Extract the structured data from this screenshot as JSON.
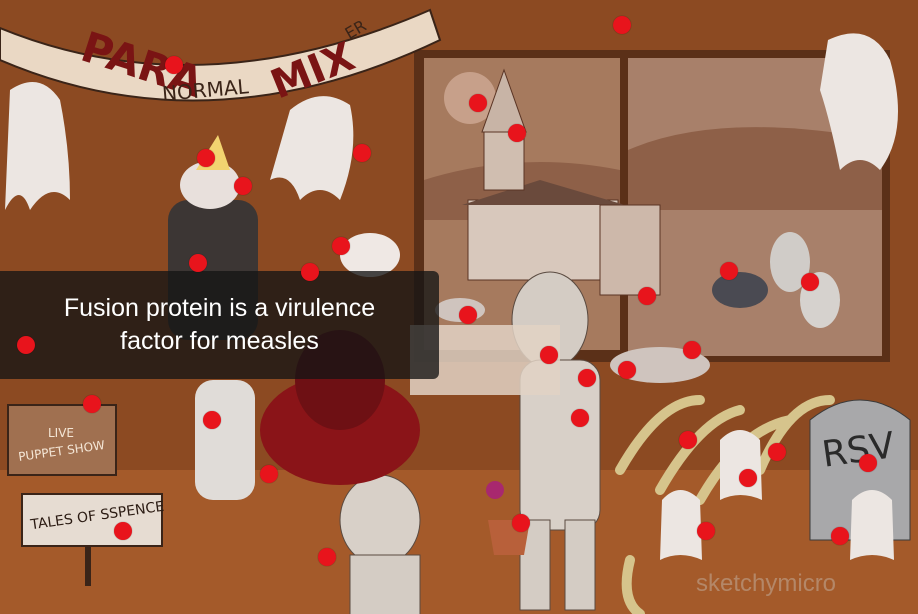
{
  "caption": {
    "line1": "Fusion protein is a virulence",
    "line2": "factor for measles"
  },
  "banner": {
    "para": "PARA",
    "normal": "NORMAL",
    "mix": "MIX",
    "er": "ER"
  },
  "signs": {
    "puppet_show_line1": "LIVE",
    "puppet_show_line2": "PUPPET SHOW",
    "tales": "TALES OF SSPENCE",
    "tombstone": "RSV"
  },
  "watermark": "sketchymicro",
  "colors": {
    "marker": "#e8141c",
    "wall": "#8a4a22",
    "caption_bg": "#141414"
  }
}
